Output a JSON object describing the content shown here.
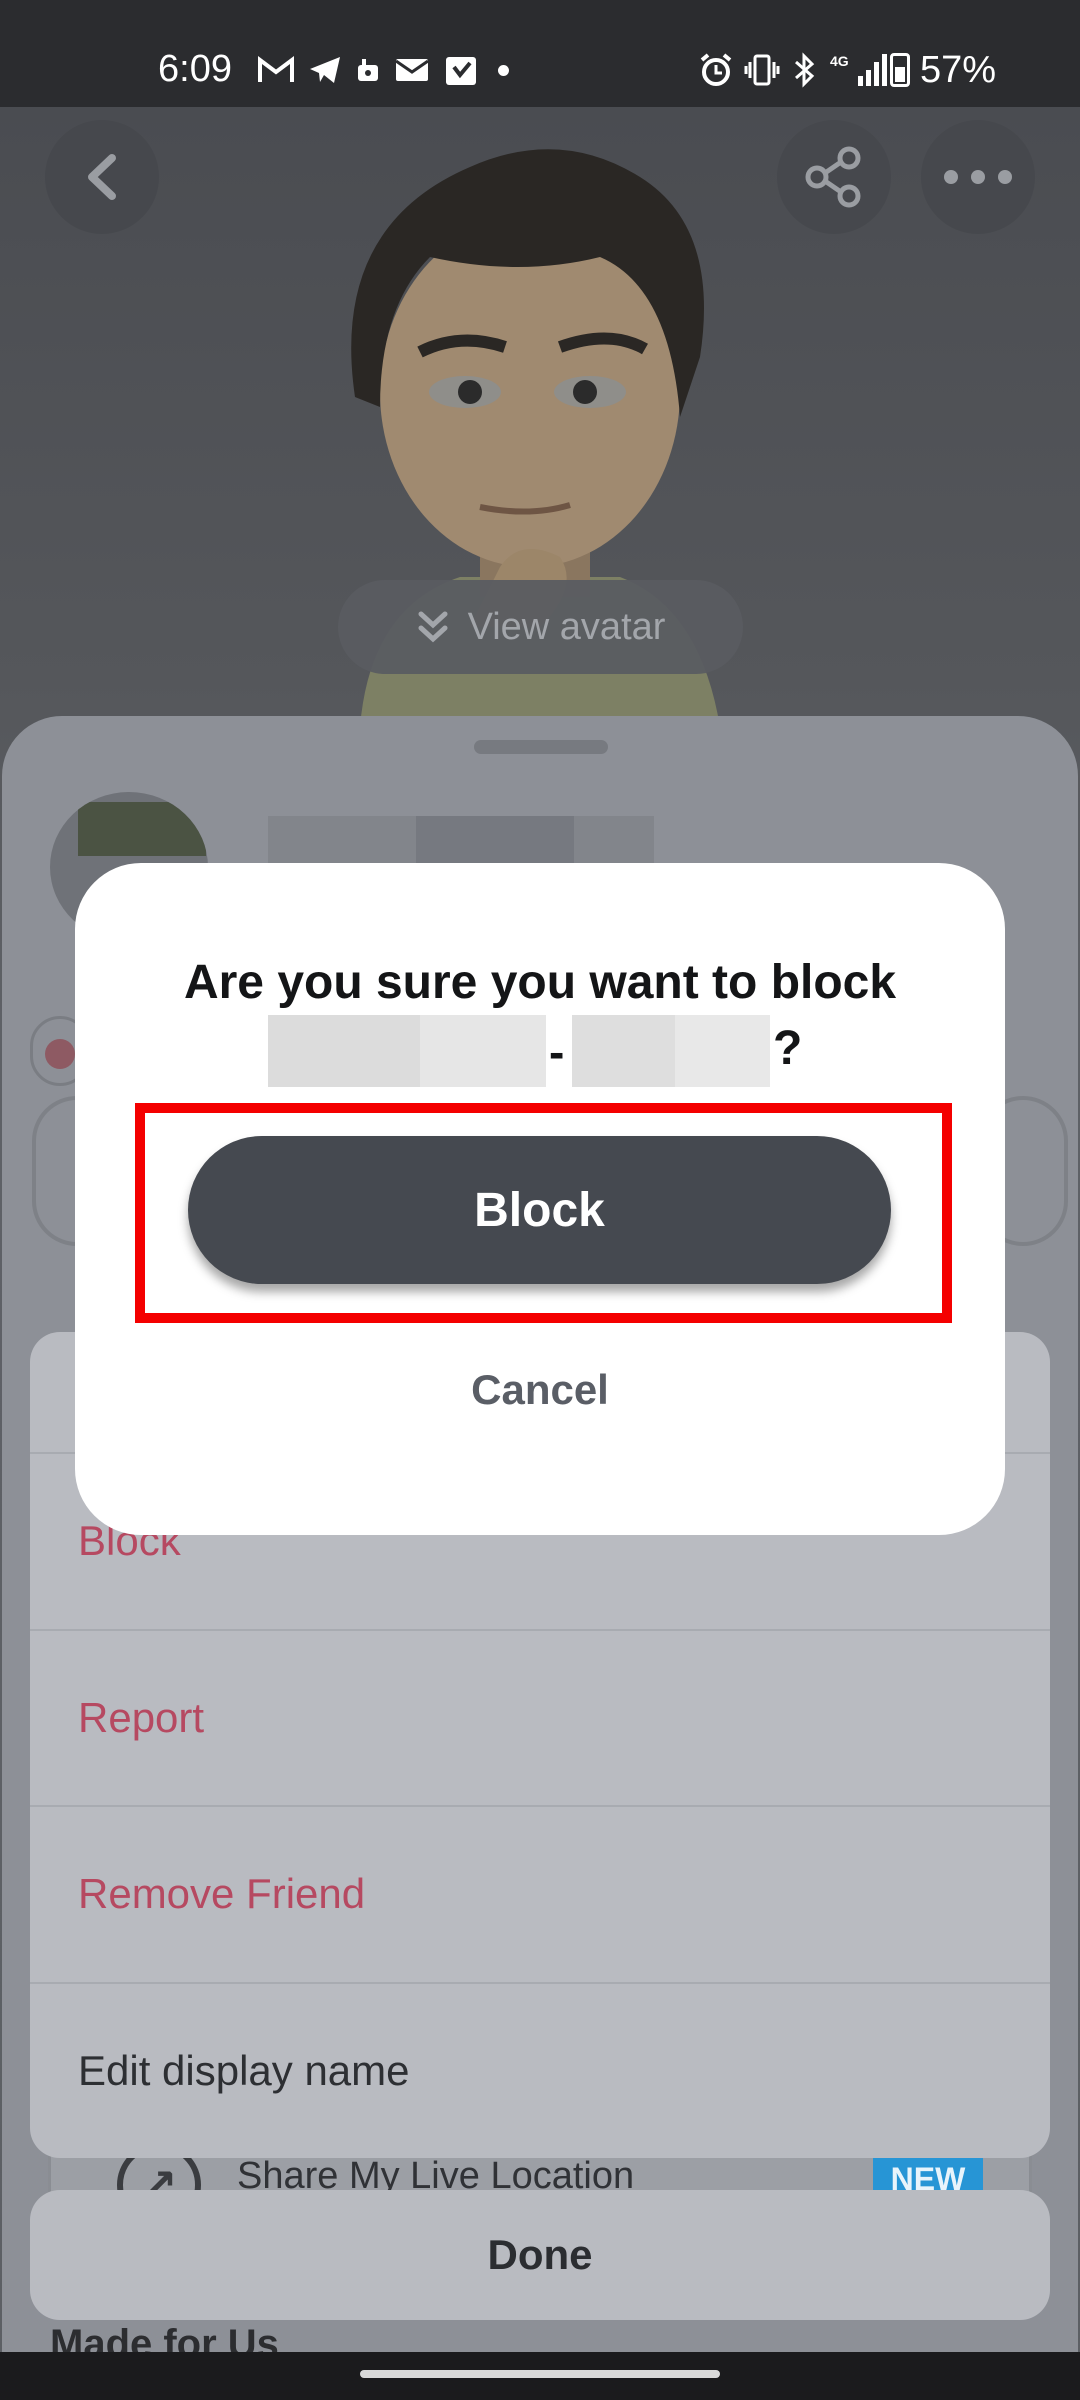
{
  "status_bar": {
    "time": "6:09",
    "battery": "57%",
    "left_icons": [
      "gmail-icon",
      "telegram-icon",
      "voicemail-icon",
      "mail-icon",
      "calendar-icon",
      "dot-icon"
    ],
    "right_icons": [
      "alarm-icon",
      "vibrate-icon",
      "bluetooth-icon",
      "4g-signal-icon",
      "battery-icon"
    ]
  },
  "header": {
    "back_icon": "chevron-left-icon",
    "share_icon": "share-icon",
    "more_icon": "more-horizontal-icon"
  },
  "avatar": {
    "view_avatar_label": "View avatar"
  },
  "profile_sheet": {
    "live_location_label": "Share My Live Location",
    "live_location_badge": "NEW",
    "section_title": "Made for Us"
  },
  "action_sheet": {
    "items": [
      {
        "label": "Block",
        "type": "danger"
      },
      {
        "label": "Report",
        "type": "danger"
      },
      {
        "label": "Remove Friend",
        "type": "danger"
      },
      {
        "label": "Edit display name",
        "type": "normal"
      }
    ],
    "done_label": "Done"
  },
  "dialog": {
    "title": "Are you sure you want to block",
    "separator": "-",
    "question_mark": "?",
    "block_label": "Block",
    "cancel_label": "Cancel"
  },
  "colors": {
    "danger_text": "#b64961",
    "block_button": "#454950",
    "highlight": "#f40000",
    "new_badge": "#2795d5"
  }
}
